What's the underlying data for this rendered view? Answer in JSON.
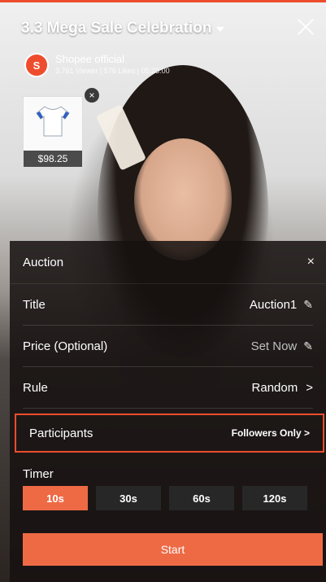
{
  "header": {
    "title": "3.3 Mega Sale Celebration",
    "host_name": "Shopee official",
    "host_stats": "3,761 Viewer | 576 Likes | 05:23:00",
    "avatar_letter": "S"
  },
  "product": {
    "price": "$98.25"
  },
  "auction_sheet": {
    "heading": "Auction",
    "close_label": "×",
    "rows": {
      "title": {
        "label": "Title",
        "value": "Auction1"
      },
      "price": {
        "label": "Price (Optional)",
        "value": "Set Now"
      },
      "rule": {
        "label": "Rule",
        "value": "Random"
      },
      "participants": {
        "label": "Participants",
        "value": "Followers Only >"
      }
    },
    "timer": {
      "label": "Timer",
      "options": [
        "10s",
        "30s",
        "60s",
        "120s"
      ],
      "selected": "10s"
    },
    "start_label": "Start"
  },
  "colors": {
    "accent": "#ee4d2d",
    "button": "#ee6a45"
  },
  "icons": {
    "pencil": "✎",
    "chevron": ">",
    "close": "×"
  }
}
